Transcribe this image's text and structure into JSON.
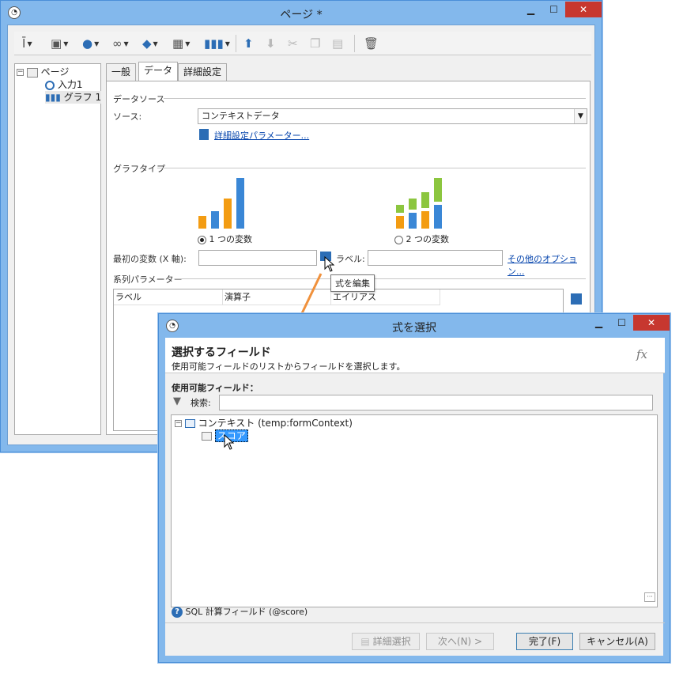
{
  "page_window": {
    "title": "ページ *",
    "controls": {
      "minimize": "▁",
      "maximize": "☐",
      "close": "✕"
    },
    "tree": {
      "root": "ページ",
      "items": [
        "入力1",
        "グラフ 1"
      ]
    },
    "tabs": [
      "一般",
      "データ",
      "詳細設定"
    ],
    "data_tab": {
      "data_source_heading": "データソース",
      "source_label": "ソース:",
      "source_value": "コンテキストデータ",
      "advanced_params_link": "詳細設定パラメーター...",
      "graph_type_heading": "グラフタイプ",
      "option_one_variable": "1 つの変数",
      "option_two_variables": "2 つの変数",
      "first_variable_label": "最初の変数 (X 軸):",
      "first_variable_value": "",
      "label_label": "ラベル:",
      "label_value": "",
      "other_options_link": "その他のオプション...",
      "series_params_heading": "系列パラメーター",
      "series_columns": [
        "ラベル",
        "演算子",
        "エイリアス"
      ]
    },
    "tooltip": "式を編集"
  },
  "dialog": {
    "title": "式を選択",
    "controls": {
      "minimize": "▁",
      "maximize": "☐",
      "close": "✕"
    },
    "header_title": "選択するフィールド",
    "header_subtitle": "使用可能フィールドのリストからフィールドを選択します。",
    "fx_symbol": "fx",
    "available_fields_label": "使用可能フィールド：",
    "search_label": "検索:",
    "search_value": "",
    "tree": {
      "root": "コンテキスト (temp:formContext)",
      "child": "スコア"
    },
    "more_symbol": "···",
    "sql_field_label": "SQL 計算フィールド (@score)",
    "buttons": {
      "advanced_select": "詳細選択",
      "next": "次へ(N) >",
      "finish": "完了(F)",
      "cancel": "キャンセル(A)"
    }
  },
  "colors": {
    "titlebar": "#83b8ec",
    "bar_orange": "#f39c12",
    "bar_blue": "#3a87d6",
    "bar_green": "#8cc63f",
    "arrow": "#f0913c",
    "link": "#0645ad",
    "close_button": "#c7372f"
  }
}
